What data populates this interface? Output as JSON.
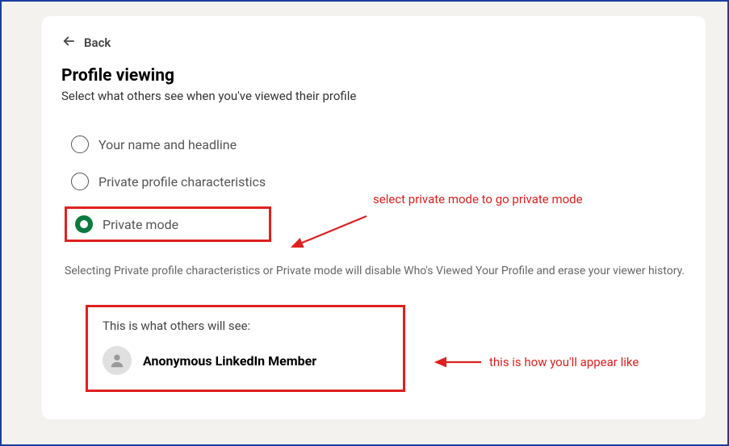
{
  "back_label": "Back",
  "title": "Profile viewing",
  "subtitle": "Select what others see when you've viewed their profile",
  "options": [
    {
      "label": "Your name and headline",
      "selected": false
    },
    {
      "label": "Private profile characteristics",
      "selected": false
    },
    {
      "label": "Private mode",
      "selected": true
    }
  ],
  "disclaimer": "Selecting Private profile characteristics or Private mode will disable Who's Viewed Your Profile and erase your viewer history.",
  "preview": {
    "heading": "This is what others will see:",
    "name": "Anonymous LinkedIn Member"
  },
  "annotations": {
    "select_text": "select private mode to go private mode",
    "appear_text": "this is how you'll appear like"
  }
}
